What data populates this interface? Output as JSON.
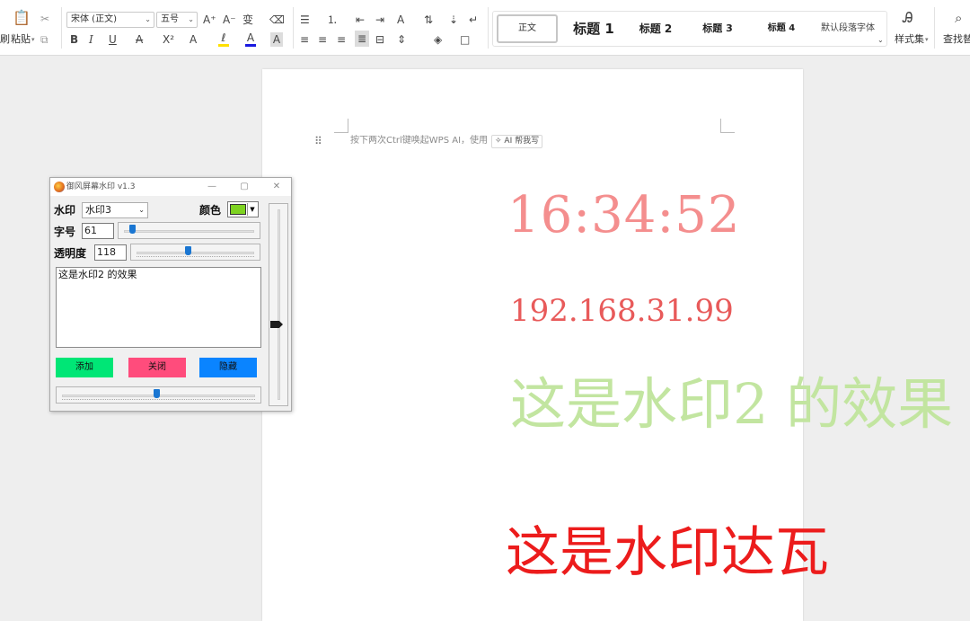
{
  "ribbon": {
    "paste_label": "粘贴",
    "paste_caret": "▾",
    "cut_icon_glyph": "✂",
    "format_painter_label": "刷",
    "font_name": "宋体 (正文)",
    "font_size": "五号",
    "grow_font": "A⁺",
    "shrink_font": "A⁻",
    "phonetic": "变",
    "clear_format": "⌫",
    "bold": "B",
    "italic": "I",
    "underline": "U",
    "strike": "A",
    "superscript": "X²",
    "text_effect": "A",
    "highlight": "ℓ",
    "font_color": "A",
    "char_shading": "A",
    "bullets": "☰",
    "numbering": "⒈",
    "outdent": "⇤",
    "indent": "⇥",
    "chinese_layout": "A",
    "sort": "⇅",
    "show_marks": "↵",
    "align_left": "≡",
    "align_center": "≡",
    "align_right": "≡",
    "justify": "≣",
    "distributed": "⊟",
    "line_spacing": "⇕",
    "shading": "◈",
    "borders": "□",
    "styles": {
      "normal": "正文",
      "h1": "标题 1",
      "h2": "标题 2",
      "h3": "标题 3",
      "h4": "标题 4",
      "default_font": "默认段落字体"
    },
    "style_set_label": "样式集",
    "find_replace_label": "查找替换"
  },
  "document": {
    "hint_text": "按下两次Ctrl键唤起WPS AI，使用",
    "ai_button": "✧ AI 帮我写"
  },
  "watermarks": {
    "time": "16:34:52",
    "ip": "192.168.31.99",
    "green_text": "这是水印2 的效果",
    "red_text": "这是水印达瓦"
  },
  "app": {
    "title": "御风屏幕水印 v1.3",
    "minimize": "—",
    "maximize": "▢",
    "close": "✕",
    "watermark_label": "水印",
    "watermark_selected": "水印3",
    "color_label": "颜色",
    "color_value": "#7ed321",
    "font_size_label": "字号",
    "font_size_value": "61",
    "opacity_label": "透明度",
    "opacity_value": "118",
    "text_content": "这是水印2 的效果",
    "add_button": "添加",
    "close_button": "关闭",
    "hide_button": "隐藏",
    "add_color": "#00e676",
    "close_color": "#ff4c7c",
    "hide_color": "#0a84ff"
  }
}
